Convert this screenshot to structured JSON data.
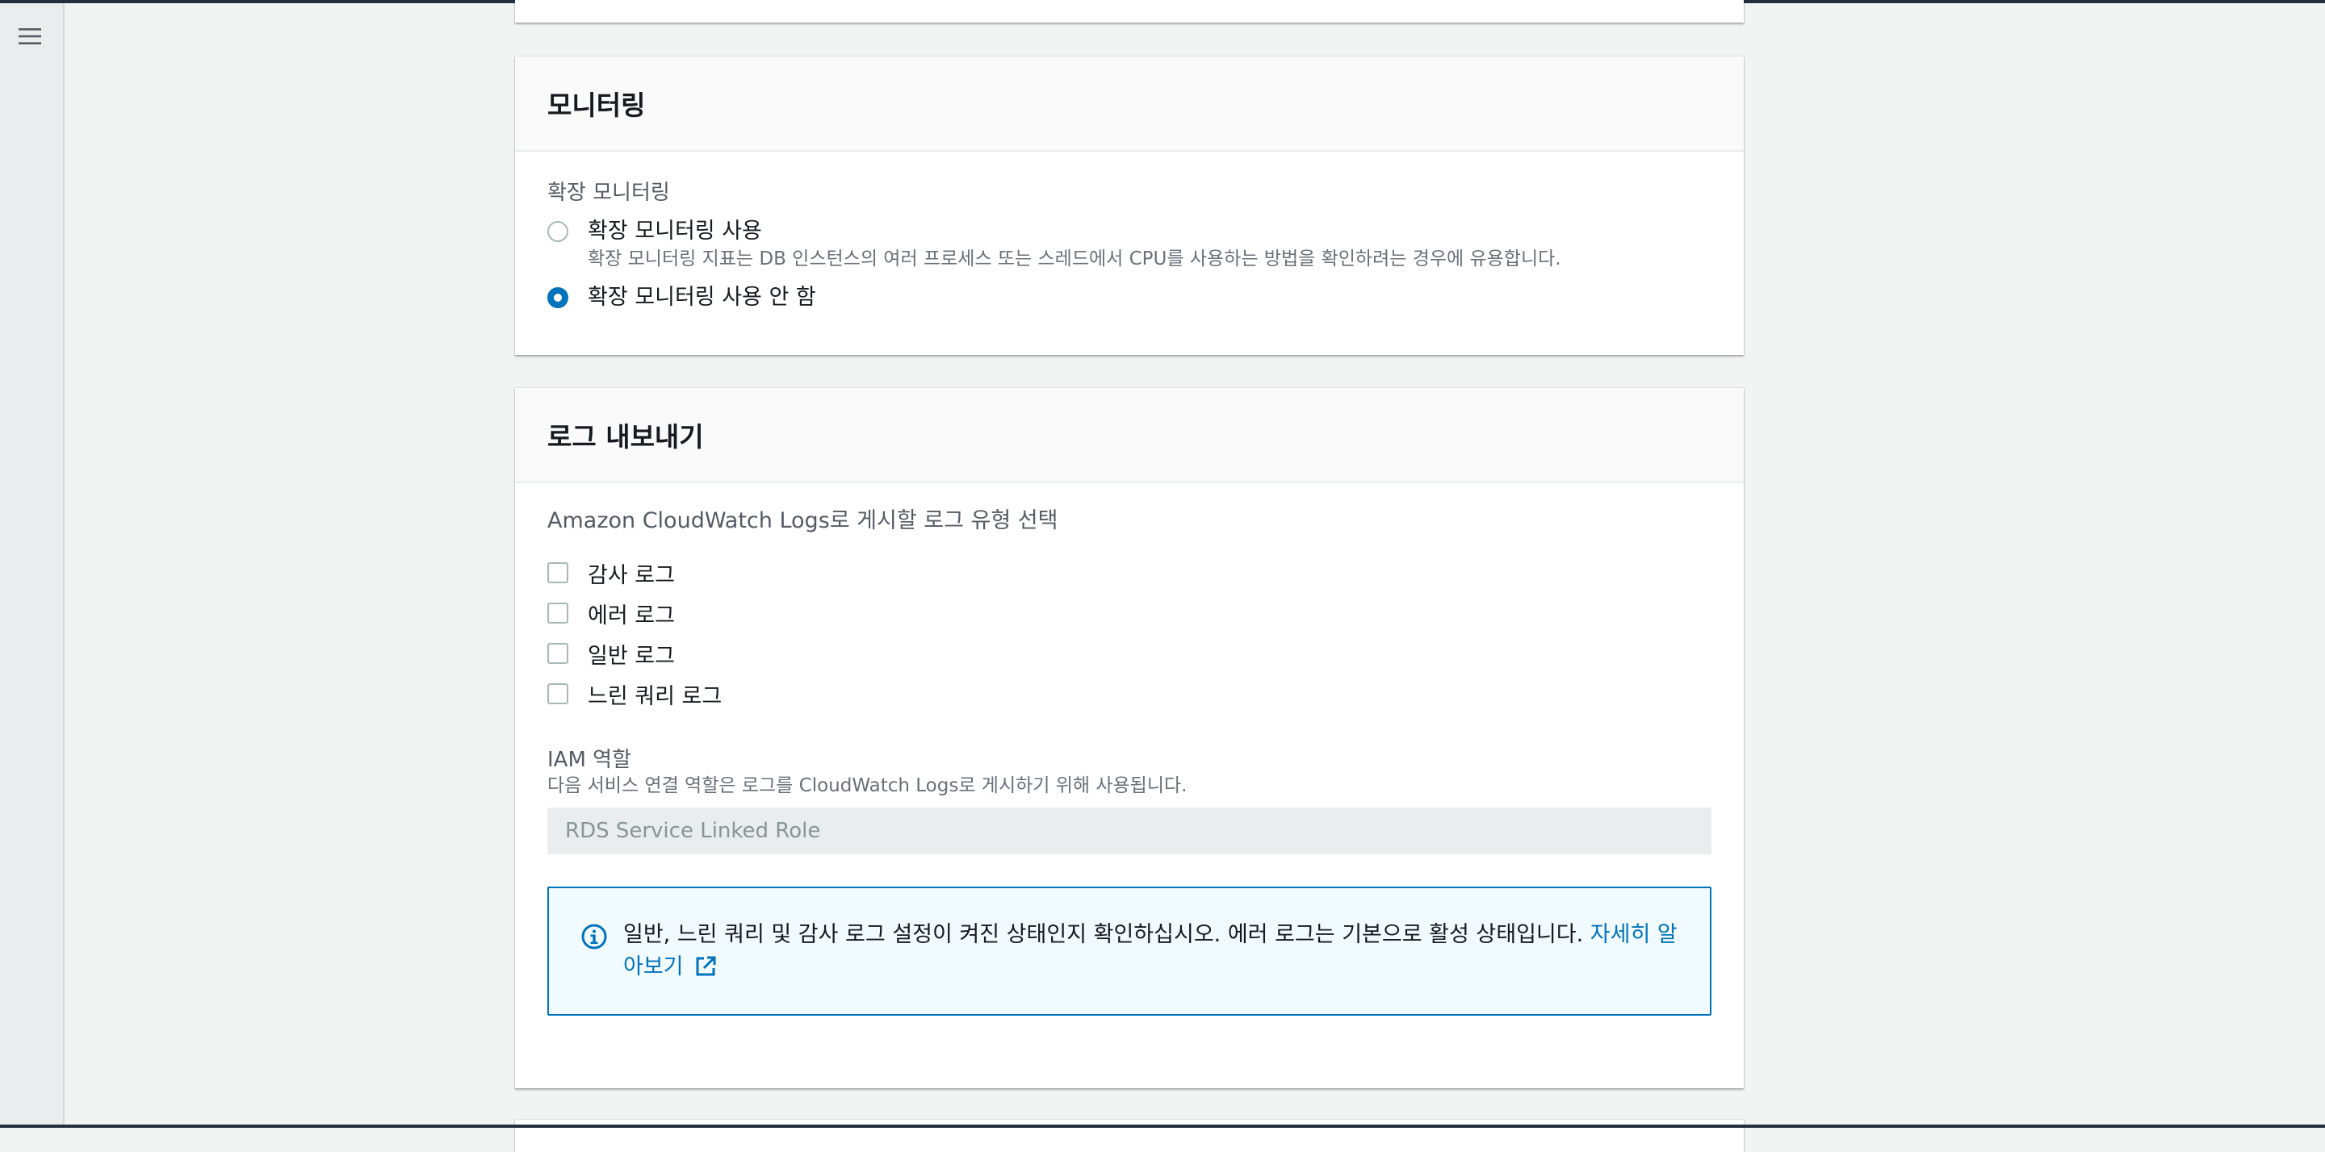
{
  "monitoring": {
    "title": "모니터링",
    "enhanced_label": "확장 모니터링",
    "options": [
      {
        "label": "확장 모니터링 사용",
        "description": "확장 모니터링 지표는 DB 인스턴스의 여러 프로세스 또는 스레드에서 CPU를 사용하는 방법을 확인하려는 경우에 유용합니다.",
        "selected": false
      },
      {
        "label": "확장 모니터링 사용 안 함",
        "description": "",
        "selected": true
      }
    ]
  },
  "log_export": {
    "title": "로그 내보내기",
    "select_label": "Amazon CloudWatch Logs로 게시할 로그 유형 선택",
    "log_types": [
      {
        "label": "감사 로그",
        "checked": false
      },
      {
        "label": "에러 로그",
        "checked": false
      },
      {
        "label": "일반 로그",
        "checked": false
      },
      {
        "label": "느린 쿼리 로그",
        "checked": false
      }
    ],
    "iam": {
      "label": "IAM 역할",
      "description": "다음 서비스 연결 역할은 로그를 CloudWatch Logs로 게시하기 위해 사용됩니다.",
      "value": "RDS Service Linked Role"
    },
    "info": {
      "text": "일반, 느린 쿼리 및 감사 로그 설정이 켜진 상태인지 확인하십시오. 에러 로그는 기본으로 활성 상태입니다. ",
      "link": "자세히 알아보기"
    }
  },
  "icons": {
    "menu": "hamburger-menu-icon",
    "info": "info-circle-icon",
    "external": "external-link-icon"
  },
  "colors": {
    "accent": "#0073bb",
    "info_bg": "#f1faff",
    "nav_bg": "#eaeded"
  }
}
